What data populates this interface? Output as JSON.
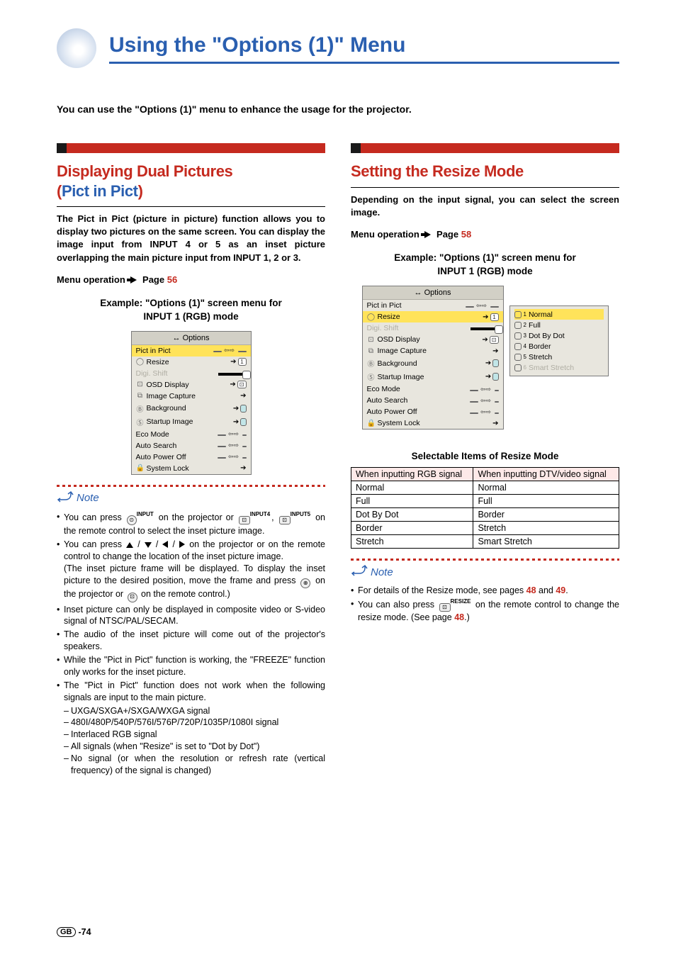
{
  "page_number": "-74",
  "region_code": "GB",
  "title": "Using the \"Options (1)\" Menu",
  "intro": "You can use the \"Options (1)\" menu to enhance the usage for the projector.",
  "left": {
    "heading_l1": "Displaying Dual Pictures",
    "heading_l2_open": "(",
    "heading_l2_inner": "Pict in Pict",
    "heading_l2_close": ")",
    "para": "The Pict in Pict (picture in picture) function allows you to display two pictures on the same screen. You can display the image input from INPUT 4 or 5 as an inset picture overlapping the main picture input from INPUT 1, 2 or 3.",
    "menu_op_label": "Menu operation",
    "menu_op_page_label": "Page",
    "menu_op_page": "56",
    "example_l1": "Example: \"Options (1)\" screen menu for",
    "example_l2": "INPUT 1 (RGB) mode",
    "menu_header": "Options",
    "menu_items": [
      {
        "label": "Pict in Pict",
        "hl": true
      },
      {
        "label": "Resize"
      },
      {
        "label": "Digi. Shift",
        "dim": true,
        "slider": true
      },
      {
        "label": "OSD Display"
      },
      {
        "label": "Image Capture"
      },
      {
        "label": "Background"
      },
      {
        "label": "Startup Image"
      },
      {
        "label": "Eco Mode"
      },
      {
        "label": "Auto Search"
      },
      {
        "label": "Auto Power Off"
      },
      {
        "label": "System Lock"
      }
    ],
    "notes": [
      {
        "text_a": "You can press ",
        "text_b": " on the projector or ",
        "text_c": ", ",
        "text_d": " on the remote control to select the inset picture image.",
        "btn1": "INPUT",
        "btn2": "INPUT4",
        "btn3": "INPUT5",
        "kind": "inputs"
      },
      {
        "text_a": "You can press ",
        "text_b": " on the projector or on the remote control to change the location of the inset picture image.",
        "text_cont": "(The inset picture frame will be displayed. To display the inset picture to the desired position, move the frame and press ",
        "text_cont2": " on the projector or ",
        "text_cont3": " on the remote control.)",
        "kind": "arrows"
      },
      {
        "text": "Inset picture can only be displayed in composite video or S-video signal of NTSC/PAL/SECAM."
      },
      {
        "text": "The audio of the inset picture will come out of the projector's speakers."
      },
      {
        "text": "While the \"Pict in Pict\" function is working, the \"FREEZE\" function only works for the inset picture."
      },
      {
        "text": "The \"Pict in Pict\" function does not work when the following signals are input to the main picture.",
        "subs": [
          "UXGA/SXGA+/SXGA/WXGA signal",
          "480I/480P/540P/576I/576P/720P/1035P/1080I signal",
          "Interlaced RGB signal",
          "All signals (when \"Resize\" is set to \"Dot by Dot\")",
          "No signal (or when the resolution or refresh rate (vertical frequency) of the signal is changed)"
        ]
      }
    ]
  },
  "right": {
    "heading": "Setting the Resize Mode",
    "para": "Depending on the input signal, you can select the screen image.",
    "menu_op_label": "Menu operation",
    "menu_op_page_label": "Page",
    "menu_op_page": "58",
    "example_l1": "Example: \"Options (1)\" screen menu for",
    "example_l2": "INPUT 1 (RGB) mode",
    "menu_header": "Options",
    "menu_items": [
      {
        "label": "Pict in Pict"
      },
      {
        "label": "Resize",
        "hl": true
      },
      {
        "label": "Digi. Shift",
        "dim": true,
        "slider": true
      },
      {
        "label": "OSD Display"
      },
      {
        "label": "Image Capture"
      },
      {
        "label": "Background"
      },
      {
        "label": "Startup Image"
      },
      {
        "label": "Eco Mode"
      },
      {
        "label": "Auto Search"
      },
      {
        "label": "Auto Power Off"
      },
      {
        "label": "System Lock"
      }
    ],
    "submenu_items": [
      {
        "num": "1",
        "label": "Normal",
        "hl": true
      },
      {
        "num": "2",
        "label": "Full"
      },
      {
        "num": "3",
        "label": "Dot By Dot"
      },
      {
        "num": "4",
        "label": "Border"
      },
      {
        "num": "5",
        "label": "Stretch"
      },
      {
        "num": "6",
        "label": "Smart Stretch",
        "dim": true
      }
    ],
    "table_caption": "Selectable Items of Resize Mode",
    "table_header_l": "When inputting RGB signal",
    "table_header_r": "When inputting DTV/video signal",
    "table_rows": [
      [
        "Normal",
        "Normal"
      ],
      [
        "Full",
        "Full"
      ],
      [
        "Dot By Dot",
        "Border"
      ],
      [
        "Border",
        "Stretch"
      ],
      [
        "Stretch",
        "Smart Stretch"
      ]
    ],
    "notes": [
      {
        "text_a": "For details of the Resize mode, see pages ",
        "p1": "48",
        "and": " and ",
        "p2": "49",
        "end": "."
      },
      {
        "text_a": "You can also press ",
        "btn": "RESIZE",
        "text_b": " on the remote control to change the resize mode. (See page ",
        "p": "48",
        "end": ".)"
      }
    ]
  }
}
